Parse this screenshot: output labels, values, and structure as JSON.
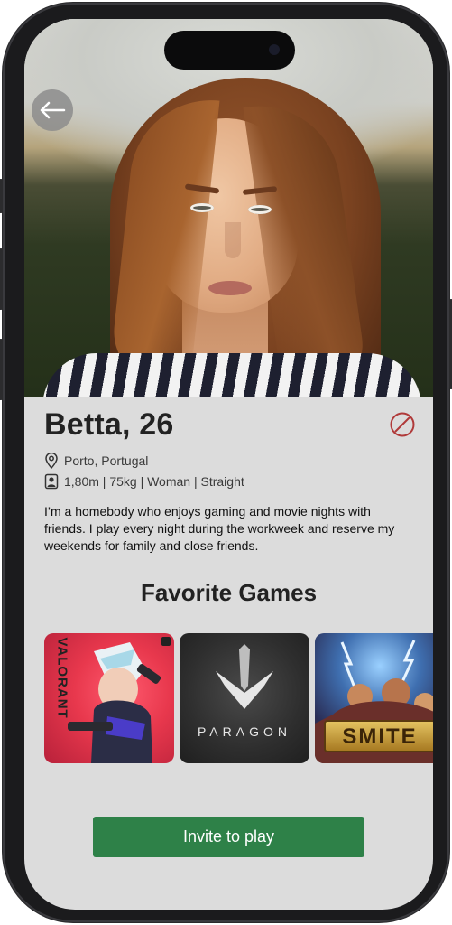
{
  "profile": {
    "name_age": "Betta, 26",
    "location": "Porto, Portugal",
    "details": "1,80m | 75kg | Woman | Straight",
    "bio": "I’m a homebody who enjoys gaming and movie nights with friends. I play every night during the workweek and reserve my weekends for family and close friends."
  },
  "icons": {
    "back": "arrow-left-icon",
    "block": "block-icon",
    "location": "location-pin-icon",
    "details": "contact-card-icon"
  },
  "favorites": {
    "title": "Favorite Games",
    "games": [
      {
        "name": "VALORANT",
        "accent": "#e8384d"
      },
      {
        "name": "PARAGON",
        "accent": "#2a2a2a"
      },
      {
        "name": "SMITE",
        "accent": "#c8a23a"
      }
    ]
  },
  "actions": {
    "invite_label": "Invite to play"
  },
  "colors": {
    "background": "#dcdcdc",
    "primary_button": "#2e8148",
    "block_icon": "#b03a3a"
  }
}
